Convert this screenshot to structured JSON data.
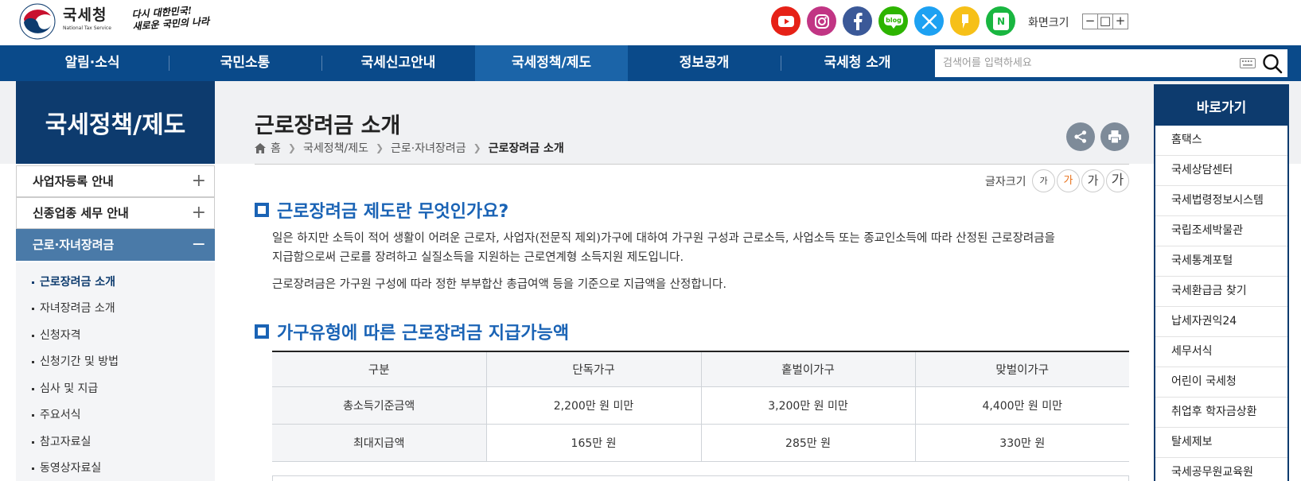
{
  "header": {
    "logo_ko": "국세청",
    "logo_en": "National Tax Service",
    "slogan_line1": "다시 대한민국!",
    "slogan_line2": "새로운 국민의 나라",
    "sns": [
      {
        "name": "youtube",
        "color": "#e62117"
      },
      {
        "name": "instagram",
        "color": "#c13584"
      },
      {
        "name": "facebook",
        "color": "#3b5998"
      },
      {
        "name": "blog",
        "color": "#2db400",
        "label": "blog"
      },
      {
        "name": "x-twitter",
        "color": "#1da1f2"
      },
      {
        "name": "kakaostory",
        "color": "#f6c018"
      },
      {
        "name": "naver-post",
        "color": "#19b640",
        "label": "N"
      }
    ],
    "screen_size_label": "화면크기",
    "zoom_out": "−",
    "zoom_reset": "□",
    "zoom_in": "+"
  },
  "nav": {
    "items": [
      "알림·소식",
      "국민소통",
      "국세신고안내",
      "국세정책/제도",
      "정보공개",
      "국세청 소개"
    ],
    "active_index": 3,
    "search_placeholder": "검색어를 입력하세요"
  },
  "sidebar": {
    "title": "국세정책/제도",
    "menus": [
      {
        "label": "사업자등록 안내",
        "toggle": "+"
      },
      {
        "label": "신종업종 세무 안내",
        "toggle": "+"
      },
      {
        "label": "근로·자녀장려금",
        "toggle": "−"
      }
    ],
    "sub_items": [
      "근로장려금 소개",
      "자녀장려금 소개",
      "신청자격",
      "신청기간 및 방법",
      "심사 및 지급",
      "주요서식",
      "참고자료실",
      "동영상자료실"
    ],
    "current_sub_index": 0
  },
  "content": {
    "title": "근로장려금 소개",
    "breadcrumb": [
      "홈",
      "국세정책/제도",
      "근로·자녀장려금",
      "근로장려금 소개"
    ],
    "font_size_label": "글자크기",
    "font_size_buttons": [
      "가",
      "가",
      "가",
      "가"
    ],
    "section1": {
      "heading": "근로장려금 제도란 무엇인가요?",
      "para1_line1": "일은 하지만 소득이 적어 생활이 어려운 근로자, 사업자(전문직 제외)가구에 대하여 가구원 구성과 근로소득, 사업소득 또는 종교인소득에 따라 산정된 근로장려금을",
      "para1_line2": "지급함으로써 근로를 장려하고 실질소득을 지원하는 근로연계형 소득지원 제도입니다.",
      "para2": "근로장려금은 가구원 구성에 따라 정한 부부합산 총급여액 등을 기준으로 지급액을 산정합니다."
    },
    "section2": {
      "heading": "가구유형에 따른 근로장려금 지급가능액",
      "table": {
        "headers": [
          "구분",
          "단독가구",
          "홑벌이가구",
          "맞벌이가구"
        ],
        "rows": [
          [
            "총소득기준금액",
            "2,200만 원 미만",
            "3,200만 원 미만",
            "4,400만 원 미만"
          ],
          [
            "최대지급액",
            "165만 원",
            "285만 원",
            "330만 원"
          ]
        ]
      }
    }
  },
  "quick_links": {
    "title": "바로가기",
    "items": [
      "홈택스",
      "국세상담센터",
      "국세법령정보시스템",
      "국립조세박물관",
      "국세통계포털",
      "국세환급금 찾기",
      "납세자권익24",
      "세무서식",
      "어린이 국세청",
      "취업후 학자금상환",
      "탈세제보",
      "국세공무원교육원"
    ]
  },
  "colors": {
    "nav_bg": "#0a4a8a",
    "nav_active": "#1b64a8",
    "sidebar_dark": "#0d3b6e",
    "sidebar_active": "#4a7aa8",
    "section_blue": "#1a63b5",
    "font_btn_active": "#e8711a"
  }
}
